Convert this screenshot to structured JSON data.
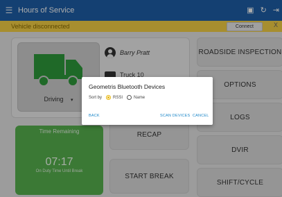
{
  "colors": {
    "appbar": "#1e5fa8",
    "banner": "#f6d146",
    "timecard": "#57b34e",
    "truck": "#2e9b3b",
    "accent": "#1a86c8"
  },
  "appbar": {
    "title": "Hours of Service",
    "icons": [
      "menu-icon",
      "truck-icon",
      "refresh-icon",
      "logout-icon"
    ]
  },
  "banner": {
    "message": "Vehicle disconnected",
    "connect_label": "Connect",
    "close_label": "X"
  },
  "driver": {
    "name": "Barry Pratt",
    "truck": "Truck 10"
  },
  "status": {
    "label": "Driving",
    "caret": "▾"
  },
  "time": {
    "label": "Time Remaining",
    "value": "07:17",
    "sublabel": "On Duty Time Until Break"
  },
  "buttons": {
    "recap": "RECAP",
    "start_break": "START BREAK",
    "roadside": "ROADSIDE INSPECTION",
    "options": "OPTIONS",
    "logs": "LOGS",
    "dvir": "DVIR",
    "shift": "SHIFT/CYCLE"
  },
  "dialog": {
    "title": "Geometris Bluetooth Devices",
    "sort_label": "Sort by",
    "options": [
      {
        "label": "RSSI",
        "selected": true
      },
      {
        "label": "Name",
        "selected": false
      }
    ],
    "back": "BACK",
    "scan": "SCAN DEVICES",
    "cancel": "CANCEL"
  }
}
